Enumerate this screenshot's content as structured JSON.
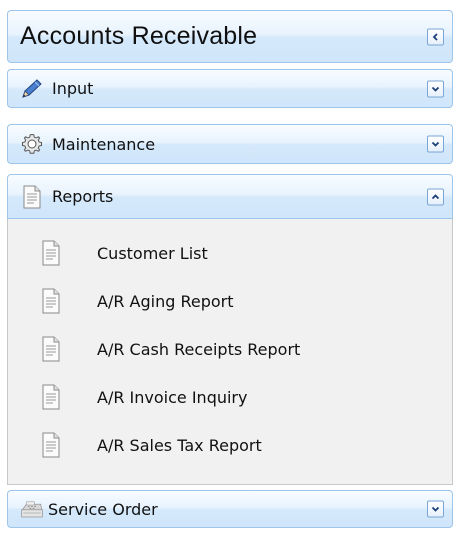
{
  "panel": {
    "title": "Accounts Receivable"
  },
  "sections": {
    "input": {
      "label": "Input",
      "icon": "pencil-icon",
      "state": "collapsed"
    },
    "maintenance": {
      "label": "Maintenance",
      "icon": "gear-icon",
      "state": "collapsed"
    },
    "reports": {
      "label": "Reports",
      "icon": "document-icon",
      "state": "expanded",
      "items": [
        {
          "label": "Customer List",
          "icon": "document-icon"
        },
        {
          "label": "A/R Aging Report",
          "icon": "document-icon"
        },
        {
          "label": "A/R Cash Receipts Report",
          "icon": "document-icon"
        },
        {
          "label": "A/R Invoice Inquiry",
          "icon": "document-icon"
        },
        {
          "label": "A/R Sales Tax Report",
          "icon": "document-icon"
        }
      ]
    },
    "service_order": {
      "label": "Service Order",
      "icon": "cash-register-icon",
      "state": "collapsed"
    }
  },
  "colors": {
    "bar_border": "#9fc5ea",
    "bar_gradient_top": "#f8fcff",
    "bar_gradient_bottom": "#cfe5fa",
    "panel_background": "#f1f1f1",
    "pencil_blue": "#3a6fc4"
  }
}
